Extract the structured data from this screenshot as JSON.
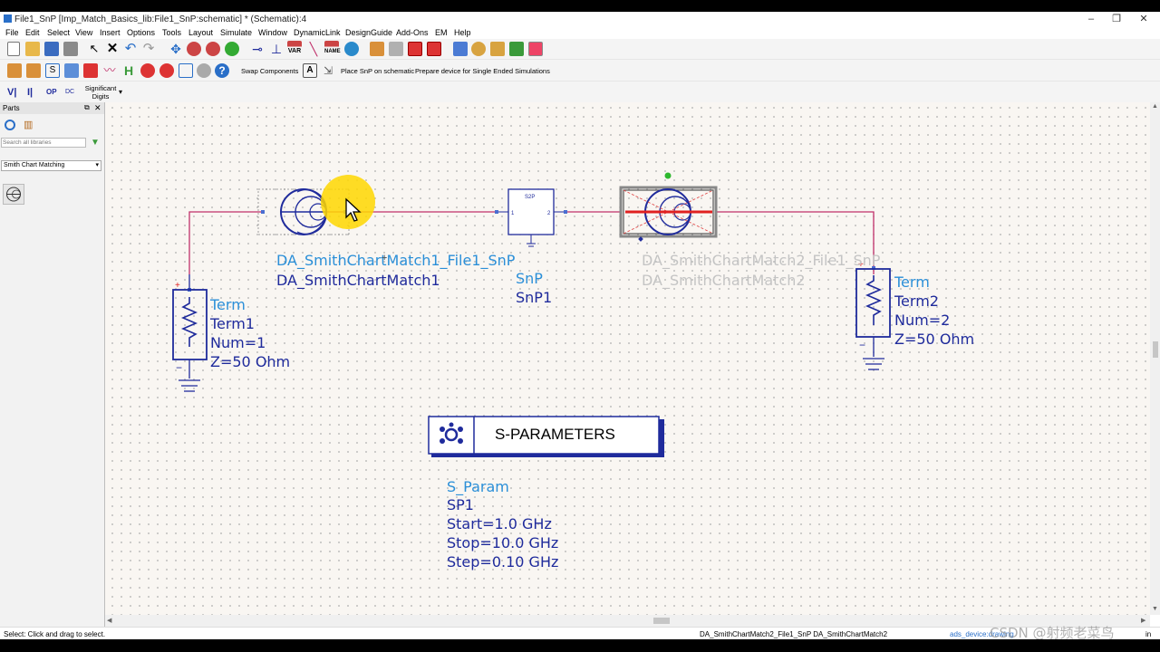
{
  "window": {
    "title": "File1_SnP [Imp_Match_Basics_lib:File1_SnP:schematic] * (Schematic):4",
    "controls": [
      "–",
      "❐",
      "✕"
    ]
  },
  "menu": [
    "File",
    "Edit",
    "Select",
    "View",
    "Insert",
    "Options",
    "Tools",
    "Layout",
    "Simulate",
    "Window",
    "DynamicLink",
    "DesignGuide",
    "Add-Ons",
    "EM",
    "Help"
  ],
  "toolbar1": {
    "icons": [
      "new-icon",
      "open-icon",
      "save-icon",
      "print-icon",
      "select-arrow-icon",
      "delete-icon",
      "undo-icon",
      "redo-icon",
      "move-icon",
      "zoom-area-icon",
      "zoom-out-icon",
      "zoom-fit-icon",
      "ground-icon",
      "port-icon",
      "var-icon",
      "wire-icon",
      "name-icon",
      "rotate-icon",
      "push-down-icon",
      "pop-up-icon",
      "deactivate-icon",
      "activate-icon",
      "simulate-icon",
      "tune-icon",
      "optimize-icon",
      "eye-icon",
      "plot-icon"
    ],
    "var_label": "VAR",
    "name_label": "NAME"
  },
  "toolbar2": {
    "swap_components": "Swap Components",
    "place_snp": "Place SnP on schematic",
    "prepare_device": "Prepare device for Single Ended Simulations"
  },
  "toolbar3": {
    "significant_digits": "Significant Digits"
  },
  "parts_panel": {
    "title": "Parts",
    "search_placeholder": "Search all libraries",
    "library": "Smith Chart Matching"
  },
  "schematic": {
    "smith1": {
      "name": "DA_SmithChartMatch1_File1_SnP",
      "instance": "DA_SmithChartMatch1"
    },
    "smith2": {
      "name": "DA_SmithChartMatch2_File1_SnP",
      "instance": "DA_SmithChartMatch2"
    },
    "snp": {
      "type": "SnP",
      "instance": "SnP1",
      "box_label": "S2P",
      "pin1": "1",
      "pin2": "2"
    },
    "term1": {
      "type": "Term",
      "instance": "Term1",
      "num": "Num=1",
      "z": "Z=50 Ohm"
    },
    "term2": {
      "type": "Term",
      "instance": "Term2",
      "num": "Num=2",
      "z": "Z=50 Ohm"
    },
    "sparam": {
      "title": "S-PARAMETERS",
      "type": "S_Param",
      "instance": "SP1",
      "start": "Start=1.0 GHz",
      "stop": "Stop=10.0 GHz",
      "step": "Step=0.10 GHz"
    }
  },
  "status": {
    "left": "Select: Click and drag to select.",
    "mid": "DA_SmithChartMatch2_File1_SnP DA_SmithChartMatch2",
    "right": "ads_device:drawing",
    "unit": "in"
  },
  "watermark": "CSDN @射频老菜鸟",
  "colors": {
    "wire": "#c0306a",
    "component": "#1f2b9c",
    "label": "#2b8fd8",
    "highlight": "#ffd700",
    "selected": "#e02020"
  }
}
